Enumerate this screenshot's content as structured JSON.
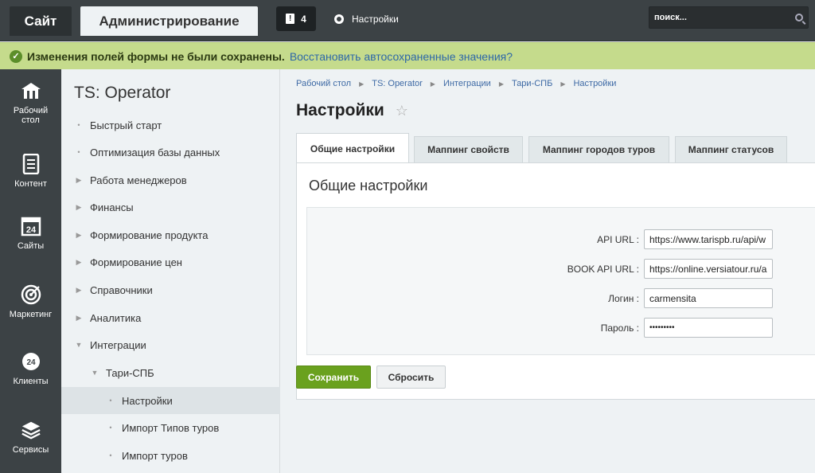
{
  "header": {
    "site_tab": "Сайт",
    "admin_tab": "Администрирование",
    "notifications_count": "4",
    "settings_label": "Настройки",
    "search_placeholder": "поиск..."
  },
  "notice": {
    "message": "Изменения полей формы не были сохранены.",
    "link": "Восстановить автосохраненные значения?"
  },
  "leftnav": [
    {
      "label": "Рабочий стол",
      "icon": "home-icon"
    },
    {
      "label": "Контент",
      "icon": "document-icon"
    },
    {
      "label": "Сайты",
      "icon": "calendar-24-icon"
    },
    {
      "label": "Маркетинг",
      "icon": "target-icon"
    },
    {
      "label": "Клиенты",
      "icon": "clients-24-icon"
    },
    {
      "label": "Сервисы",
      "icon": "layers-icon"
    }
  ],
  "menu": {
    "title": "TS: Operator",
    "items": [
      {
        "label": "Быстрый старт",
        "marker": "•"
      },
      {
        "label": "Оптимизация базы данных",
        "marker": "•"
      },
      {
        "label": "Работа менеджеров",
        "marker": "▶"
      },
      {
        "label": "Финансы",
        "marker": "▶"
      },
      {
        "label": "Формирование продукта",
        "marker": "▶"
      },
      {
        "label": "Формирование цен",
        "marker": "▶"
      },
      {
        "label": "Справочники",
        "marker": "▶"
      },
      {
        "label": "Аналитика",
        "marker": "▶"
      },
      {
        "label": "Интеграции",
        "marker": "▼"
      },
      {
        "label": "Тари-СПБ",
        "marker": "▼"
      },
      {
        "label": "Настройки",
        "marker": "•"
      },
      {
        "label": "Импорт Типов туров",
        "marker": "•"
      },
      {
        "label": "Импорт туров",
        "marker": "•"
      }
    ]
  },
  "breadcrumb": [
    "Рабочий стол",
    "TS: Operator",
    "Интеграции",
    "Тари-СПБ",
    "Настройки"
  ],
  "page_title": "Настройки",
  "tabs": [
    "Общие настройки",
    "Маппинг свойств",
    "Маппинг городов туров",
    "Маппинг статусов"
  ],
  "panel": {
    "title": "Общие настройки",
    "fields": [
      {
        "label": "API URL :",
        "value": "https://www.tarispb.ru/api/w"
      },
      {
        "label": "BOOK API URL :",
        "value": "https://online.versiatour.ru/a"
      },
      {
        "label": "Логин :",
        "value": "carmensita"
      },
      {
        "label": "Пароль :",
        "value": "•••••••••"
      }
    ]
  },
  "buttons": {
    "save": "Сохранить",
    "reset": "Сбросить"
  },
  "colors": {
    "topbar": "#3c4245",
    "notice": "#c5db8c",
    "save_button": "#6aa11e",
    "link": "#3e6aa5"
  }
}
